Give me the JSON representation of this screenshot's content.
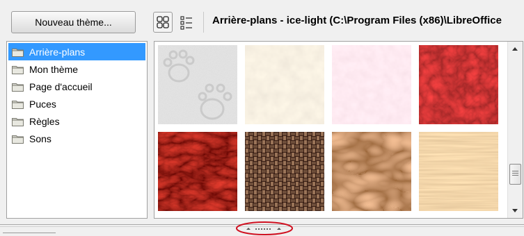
{
  "toolbar": {
    "new_theme_label": "Nouveau thème...",
    "path_title": "Arrière-plans - ice-light (C:\\Program Files (x86)\\LibreOffice"
  },
  "themes": [
    {
      "label": "Arrière-plans",
      "selected": true
    },
    {
      "label": "Mon thème",
      "selected": false
    },
    {
      "label": "Page d'accueil",
      "selected": false
    },
    {
      "label": "Puces",
      "selected": false
    },
    {
      "label": "Règles",
      "selected": false
    },
    {
      "label": "Sons",
      "selected": false
    }
  ],
  "backgrounds": [
    {
      "name": "ice-light"
    },
    {
      "name": "cream"
    },
    {
      "name": "pink"
    },
    {
      "name": "red-roses"
    },
    {
      "name": "dark-red-marble"
    },
    {
      "name": "woven-basket"
    },
    {
      "name": "chocolate-swirl"
    },
    {
      "name": "light-wood"
    }
  ],
  "icons": {
    "icon_view": "grid-view-icon",
    "detail_view": "list-view-icon",
    "folder": "folder-icon"
  },
  "colors": {
    "selection": "#3399ff",
    "highlight_ellipse": "#d01020"
  }
}
